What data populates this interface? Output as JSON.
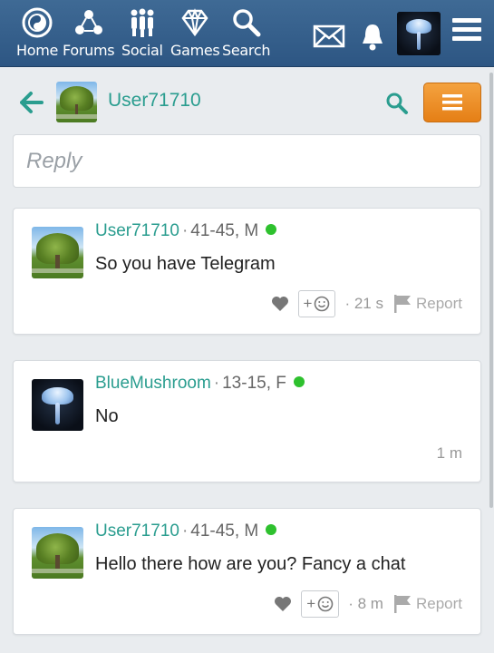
{
  "nav": {
    "items": [
      {
        "label": "Home",
        "icon": "home-icon"
      },
      {
        "label": "Forums",
        "icon": "forums-icon"
      },
      {
        "label": "Social",
        "icon": "social-icon"
      },
      {
        "label": "Games",
        "icon": "games-icon"
      },
      {
        "label": "Search",
        "icon": "search-icon"
      }
    ],
    "mail_icon": "mail-icon",
    "bell_icon": "bell-icon",
    "menu_icon": "hamburger-icon"
  },
  "header": {
    "username": "User71710",
    "back_icon": "back-arrow-icon",
    "search_icon": "search-icon"
  },
  "reply": {
    "placeholder": "Reply"
  },
  "messages": [
    {
      "user": "User71710",
      "age_gender": "41-45, M",
      "text": "So you have Telegram",
      "time": "21 s",
      "report": "Report",
      "online": true
    },
    {
      "user": "BlueMushroom",
      "age_gender": "13-15, F",
      "text": "No",
      "time": "1 m",
      "online": true
    },
    {
      "user": "User71710",
      "age_gender": "41-45, M",
      "text": "Hello there how are you? Fancy a chat",
      "time": "8 m",
      "report": "Report",
      "online": true
    }
  ],
  "colors": {
    "nav_bg": "#2d5683",
    "accent": "#2a9d8f",
    "menu_button": "#ee8f27",
    "online": "#2ec12e"
  }
}
